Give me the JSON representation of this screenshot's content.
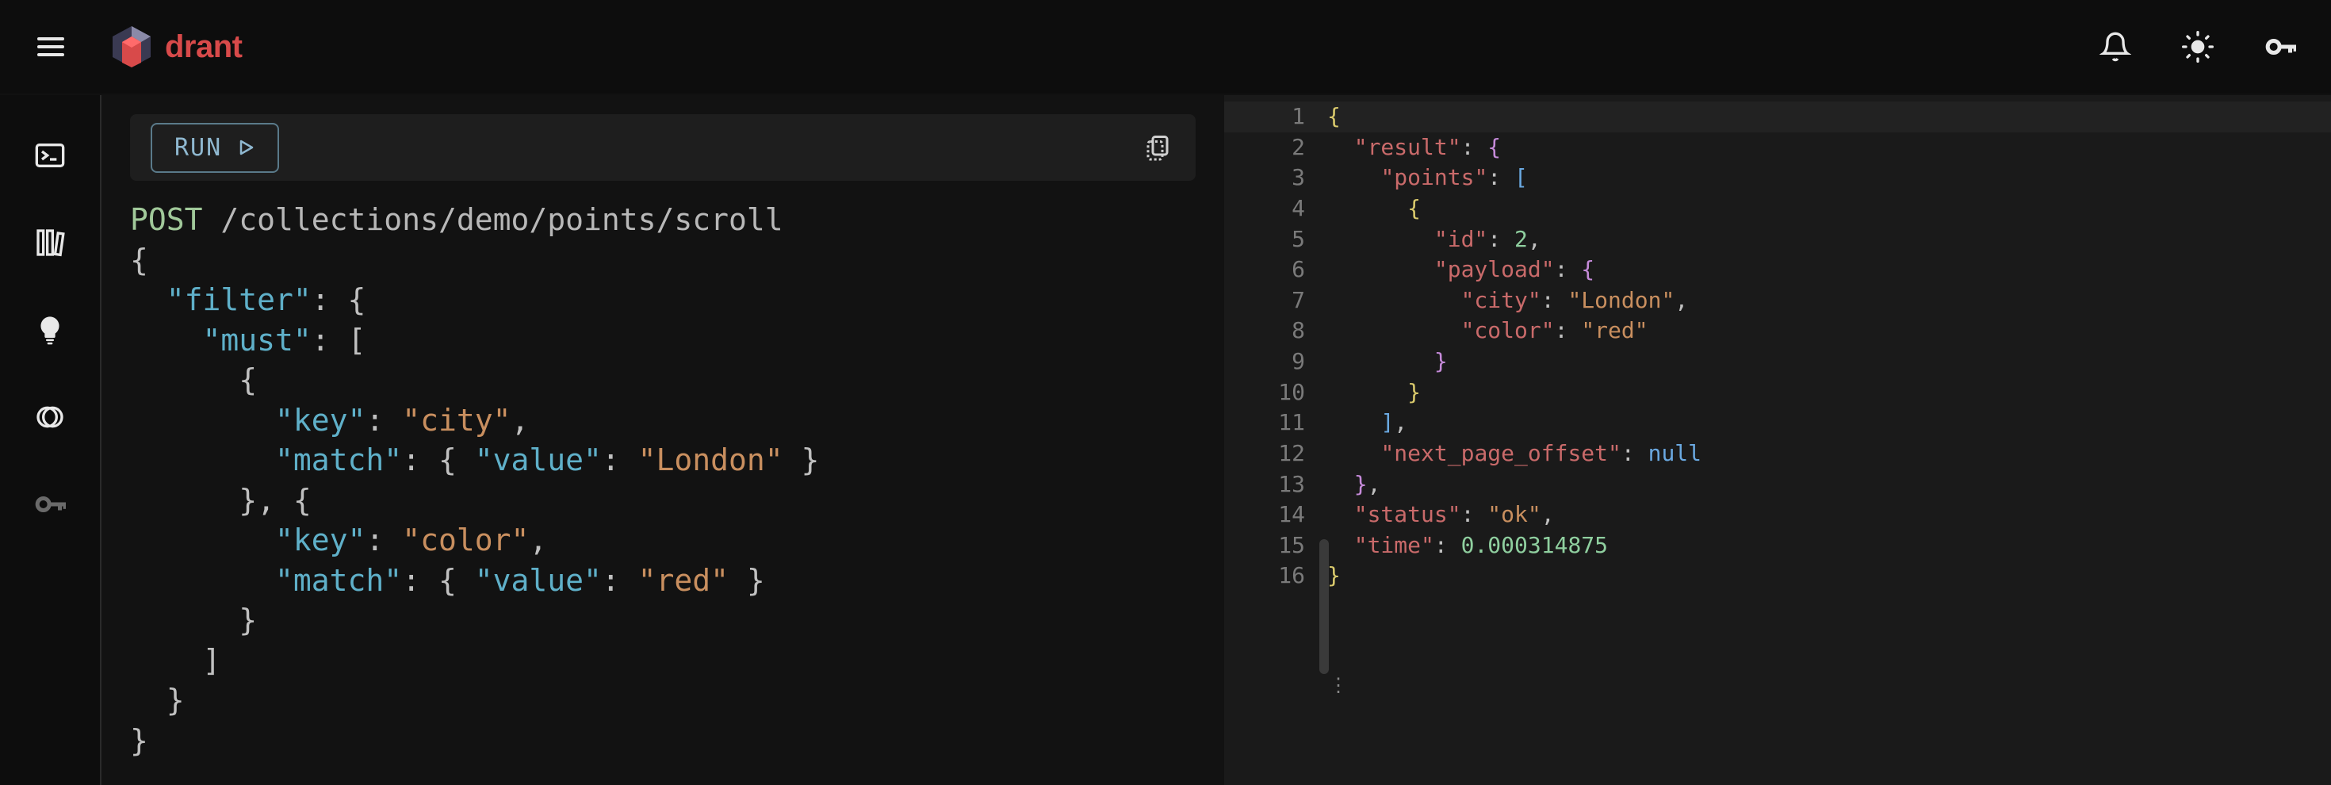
{
  "topbar": {
    "brand": "drant"
  },
  "run": {
    "label": "RUN"
  },
  "request": {
    "method": "POST",
    "path": "/collections/demo/points/scroll",
    "body": {
      "filter": {
        "must": [
          {
            "key": "city",
            "match": {
              "value": "London"
            }
          },
          {
            "key": "color",
            "match": {
              "value": "red"
            }
          }
        ]
      }
    }
  },
  "response": {
    "lines": [
      {
        "n": "1",
        "indent": 0,
        "tokens": [
          [
            "brace",
            "{"
          ]
        ]
      },
      {
        "n": "2",
        "indent": 1,
        "tokens": [
          [
            "key",
            "\"result\""
          ],
          [
            "punc",
            ": "
          ],
          [
            "brace2",
            "{"
          ]
        ]
      },
      {
        "n": "3",
        "indent": 2,
        "tokens": [
          [
            "key",
            "\"points\""
          ],
          [
            "punc",
            ": "
          ],
          [
            "brace3",
            "["
          ]
        ]
      },
      {
        "n": "4",
        "indent": 3,
        "tokens": [
          [
            "brace",
            "{"
          ]
        ]
      },
      {
        "n": "5",
        "indent": 4,
        "tokens": [
          [
            "key",
            "\"id\""
          ],
          [
            "punc",
            ": "
          ],
          [
            "num",
            "2"
          ],
          [
            "punc",
            ","
          ]
        ]
      },
      {
        "n": "6",
        "indent": 4,
        "tokens": [
          [
            "key",
            "\"payload\""
          ],
          [
            "punc",
            ": "
          ],
          [
            "brace2",
            "{"
          ]
        ]
      },
      {
        "n": "7",
        "indent": 5,
        "tokens": [
          [
            "key",
            "\"city\""
          ],
          [
            "punc",
            ": "
          ],
          [
            "str",
            "\"London\""
          ],
          [
            "punc",
            ","
          ]
        ]
      },
      {
        "n": "8",
        "indent": 5,
        "tokens": [
          [
            "key",
            "\"color\""
          ],
          [
            "punc",
            ": "
          ],
          [
            "str",
            "\"red\""
          ]
        ]
      },
      {
        "n": "9",
        "indent": 4,
        "tokens": [
          [
            "brace2",
            "}"
          ]
        ]
      },
      {
        "n": "10",
        "indent": 3,
        "tokens": [
          [
            "brace",
            "}"
          ]
        ]
      },
      {
        "n": "11",
        "indent": 2,
        "tokens": [
          [
            "brace3",
            "]"
          ],
          [
            "punc",
            ","
          ]
        ]
      },
      {
        "n": "12",
        "indent": 2,
        "tokens": [
          [
            "key",
            "\"next_page_offset\""
          ],
          [
            "punc",
            ": "
          ],
          [
            "null",
            "null"
          ]
        ]
      },
      {
        "n": "13",
        "indent": 1,
        "tokens": [
          [
            "brace2",
            "}"
          ],
          [
            "punc",
            ","
          ]
        ]
      },
      {
        "n": "14",
        "indent": 1,
        "tokens": [
          [
            "key",
            "\"status\""
          ],
          [
            "punc",
            ": "
          ],
          [
            "str",
            "\"ok\""
          ],
          [
            "punc",
            ","
          ]
        ]
      },
      {
        "n": "15",
        "indent": 1,
        "tokens": [
          [
            "key",
            "\"time\""
          ],
          [
            "punc",
            ": "
          ],
          [
            "num",
            "0.000314875"
          ]
        ]
      },
      {
        "n": "16",
        "indent": 0,
        "tokens": [
          [
            "brace",
            "}"
          ]
        ]
      }
    ]
  }
}
